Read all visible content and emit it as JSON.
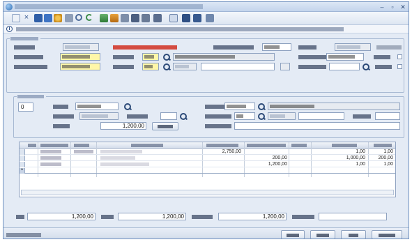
{
  "window": {
    "min_glyph": "–",
    "max_glyph": "▫",
    "close_glyph": "✕"
  },
  "icons": [
    "app-icon",
    "cut-icon",
    "close-icon",
    "save-icon",
    "save-as-icon",
    "settings-icon",
    "print-icon",
    "search-icon",
    "refresh-icon",
    "user-icon",
    "users-icon",
    "print-preview-icon",
    "calc-icon",
    "doc-icon",
    "grid-icon",
    "info-icon"
  ],
  "colors": {
    "accent": "#d23a2c",
    "required_field": "#fff7a8",
    "title_bar": "#c3d4ec"
  },
  "infobar": {
    "icon": "i"
  },
  "header": {
    "selector": "0"
  },
  "detail": {
    "amount": "1,200,00",
    "values_row": [
      "2,750,00",
      "200,00",
      "1,200,00",
      "1,000,00",
      "1,00",
      "200,00"
    ]
  },
  "totals": {
    "imponibile": "1,200,00",
    "iva": "1,200,00",
    "totale": "1,200,00"
  },
  "grid": {
    "row_markers": [
      "",
      "",
      "",
      "*"
    ]
  }
}
